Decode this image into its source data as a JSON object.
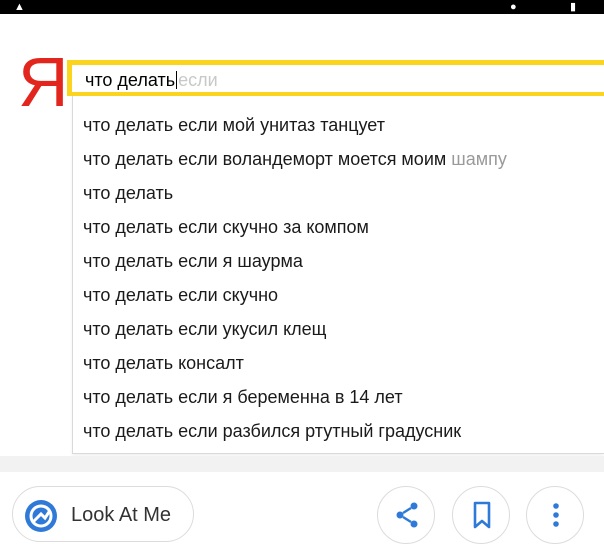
{
  "search": {
    "query": "что делать",
    "hint": "если"
  },
  "suggestions": [
    {
      "text": "что делать если мой унитаз танцует",
      "tail": ""
    },
    {
      "text": "что делать если воландеморт моется моим ",
      "tail": "шампу"
    },
    {
      "text": "что делать",
      "tail": ""
    },
    {
      "text": "что делать если скучно за компом",
      "tail": ""
    },
    {
      "text": "что делать если я шаурма",
      "tail": ""
    },
    {
      "text": "что делать если скучно",
      "tail": ""
    },
    {
      "text": "что делать если укусил клещ",
      "tail": ""
    },
    {
      "text": "что делать консалт",
      "tail": ""
    },
    {
      "text": "что делать если я беременна в 14 лет",
      "tail": ""
    },
    {
      "text": "что делать если разбился ртутный градусник",
      "tail": ""
    }
  ],
  "logo": {
    "text": "Я",
    "color": "#e3261d"
  },
  "colors": {
    "search_border": "#fbd41e",
    "source_icon": "#2f7ad8"
  },
  "source": {
    "label": "Look At Me",
    "icon": "look-at-me-logo"
  },
  "actions": {
    "share_icon": "share-icon",
    "bookmark_icon": "bookmark-icon",
    "more_icon": "more-vertical-icon"
  }
}
